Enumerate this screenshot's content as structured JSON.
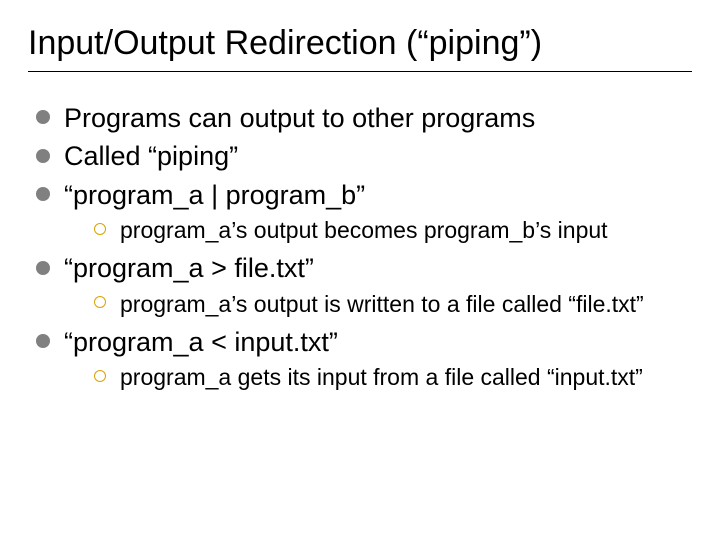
{
  "title": "Input/Output Redirection (“piping”)",
  "bullets": [
    {
      "text": "Programs can output to other programs",
      "children": []
    },
    {
      "text": "Called “piping”",
      "children": []
    },
    {
      "text": "“program_a | program_b”",
      "children": [
        "program_a’s output becomes program_b’s input"
      ]
    },
    {
      "text": "“program_a > file.txt”",
      "children": [
        "program_a’s output is written to a file called “file.txt”"
      ]
    },
    {
      "text": " “program_a < input.txt”",
      "children": [
        "program_a gets its input from a file called “input.txt”"
      ]
    }
  ]
}
